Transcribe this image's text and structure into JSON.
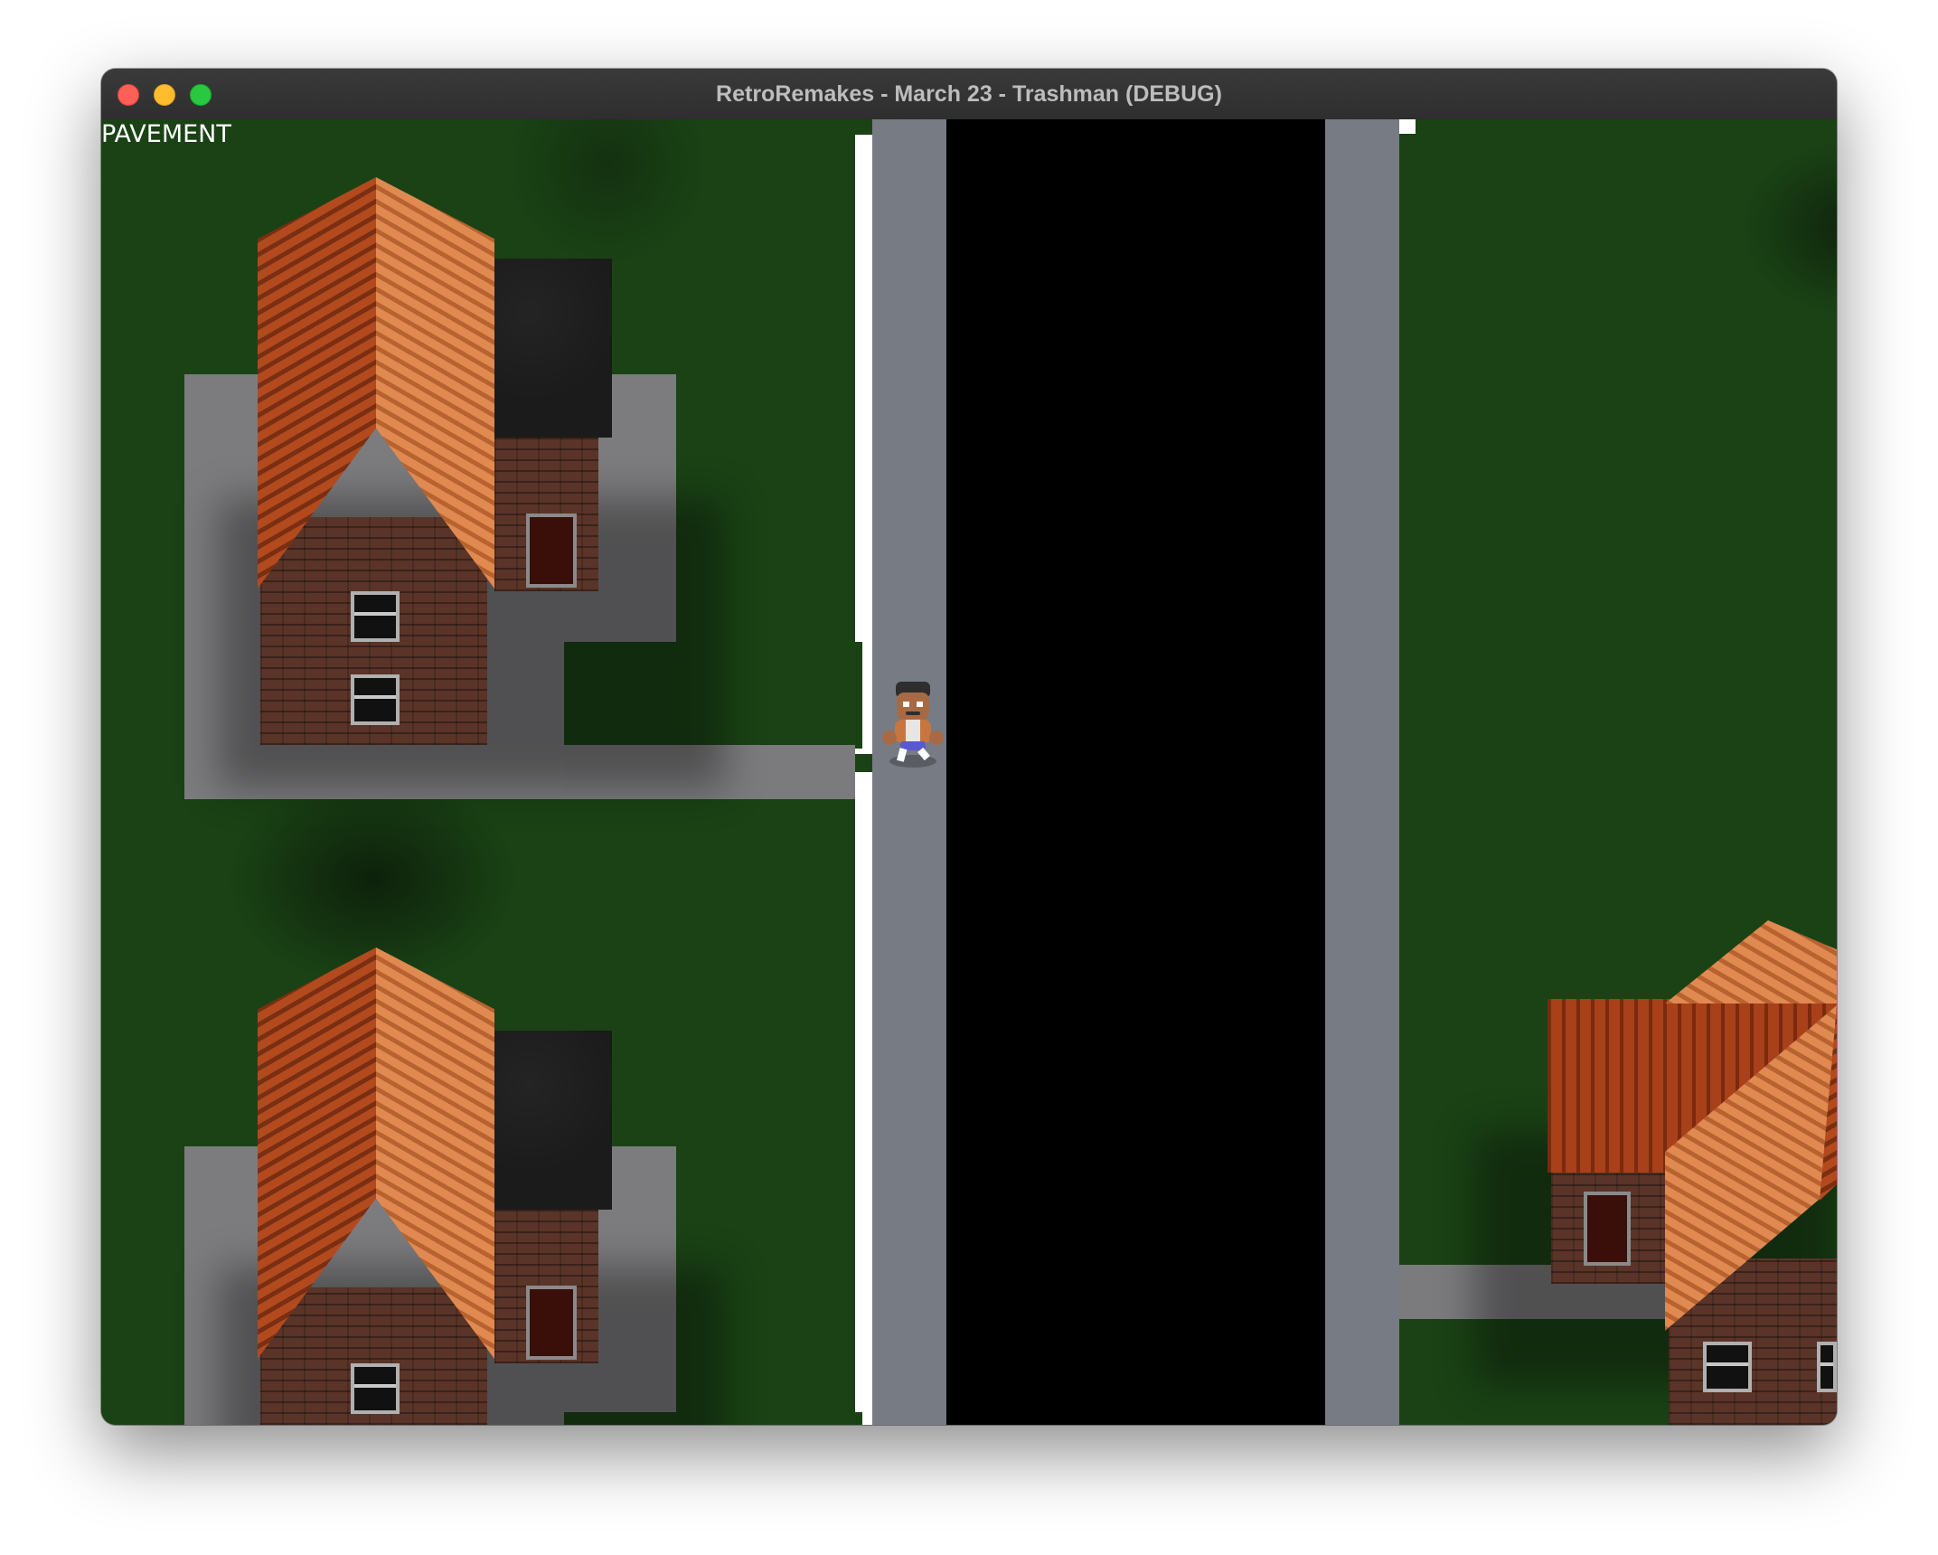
{
  "window": {
    "title": "RetroRemakes - March 23 - Trashman (DEBUG)"
  },
  "hud": {
    "debug_label": "PAVEMENT"
  },
  "colors": {
    "grass": "#1a4215",
    "pavement": "#777b84",
    "road": "#000000",
    "curb": "#ffffff",
    "roof_terracotta": "#d9824a",
    "roof_dark": "#1b1b1b",
    "brick": "#5a3428"
  },
  "icons": {
    "close": "close-icon",
    "minimize": "minimize-icon",
    "maximize": "maximize-icon"
  }
}
